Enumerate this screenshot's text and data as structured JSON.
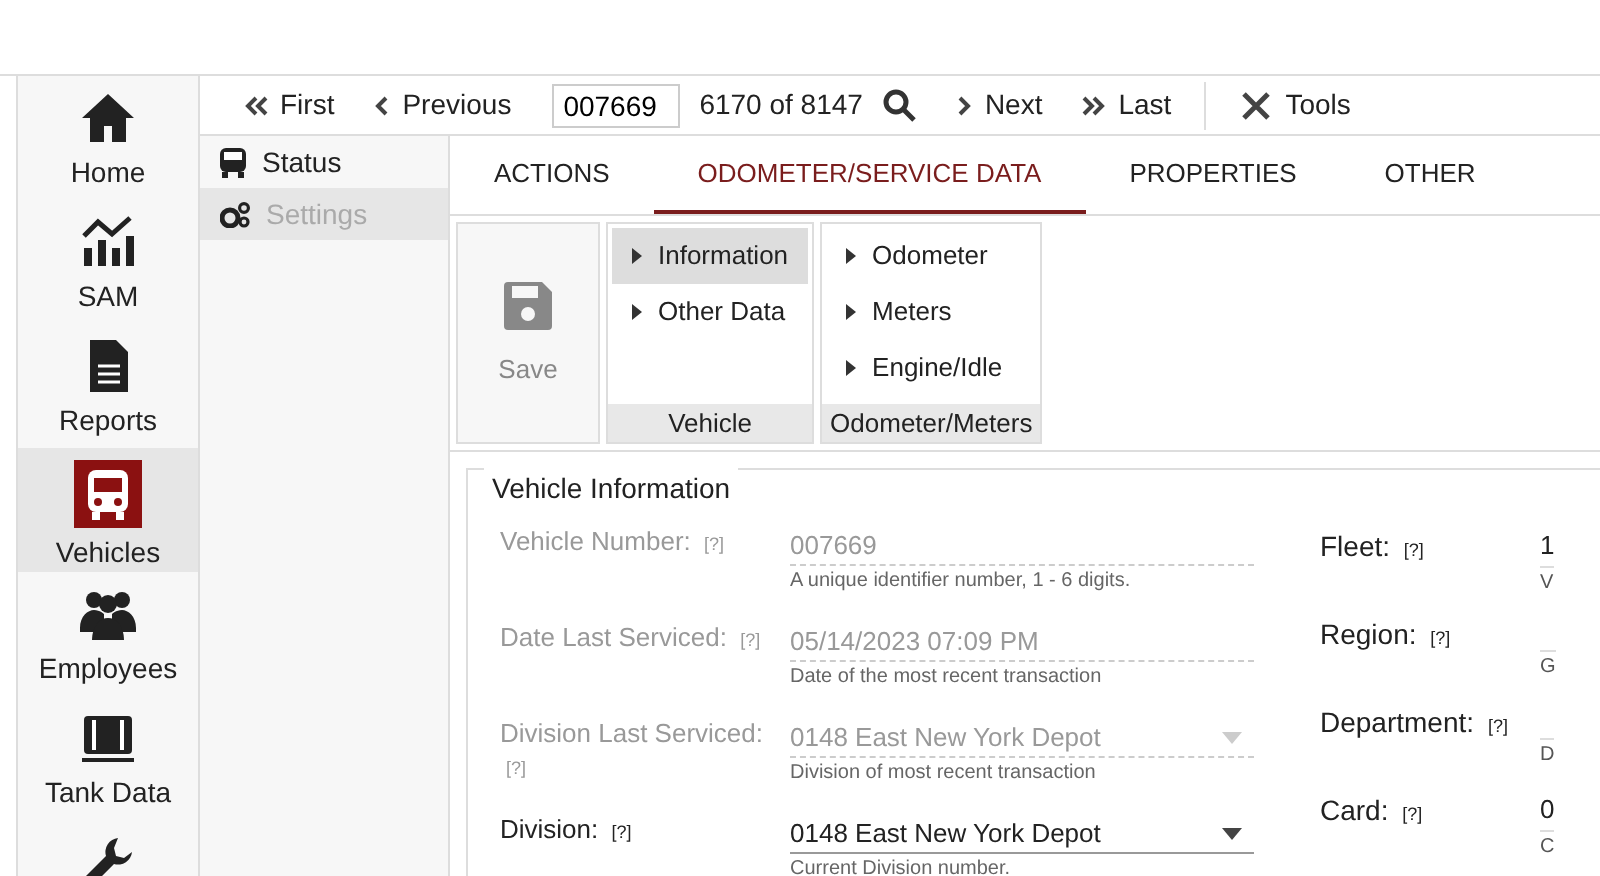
{
  "nav": [
    {
      "kind": "home",
      "label": "Home",
      "selected": false
    },
    {
      "kind": "chart",
      "label": "SAM",
      "selected": false
    },
    {
      "kind": "document",
      "label": "Reports",
      "selected": false
    },
    {
      "kind": "bus",
      "label": "Vehicles",
      "selected": true
    },
    {
      "kind": "people",
      "label": "Employees",
      "selected": false
    },
    {
      "kind": "tank",
      "label": "Tank Data",
      "selected": false
    },
    {
      "kind": "wrench",
      "selected": false
    }
  ],
  "toolbar": {
    "first": "First",
    "previous": "Previous",
    "record": "007669",
    "position": "6170 of 8147",
    "next": "Next",
    "last": "Last",
    "tools": "Tools"
  },
  "submenu": [
    {
      "kind": "bus",
      "label": "Status",
      "selected": false
    },
    {
      "kind": "gears",
      "label": "Settings",
      "selected": true
    }
  ],
  "tabs": [
    {
      "label": "ACTIONS",
      "selected": false
    },
    {
      "label": "ODOMETER/SERVICE DATA",
      "selected": true
    },
    {
      "label": "PROPERTIES",
      "selected": false
    },
    {
      "label": "OTHER",
      "selected": false
    }
  ],
  "ribbon": {
    "save": {
      "label": "Save",
      "disabled": true
    },
    "groups": [
      {
        "title": "Vehicle",
        "items": [
          {
            "label": "Information",
            "selected": true
          },
          {
            "label": "Other Data",
            "selected": false
          }
        ]
      },
      {
        "title": "Odometer/Meters",
        "items": [
          {
            "label": "Odometer",
            "selected": false
          },
          {
            "label": "Meters",
            "selected": false
          },
          {
            "label": "Engine/Idle",
            "selected": false
          }
        ]
      }
    ]
  },
  "section": {
    "title": "Vehicle Information",
    "fields": [
      {
        "kind": "text",
        "label": "Vehicle Number:",
        "help": "[?]",
        "value": "007669",
        "hint": "A unique identifier number, 1 - 6 digits.",
        "disabled": true
      },
      {
        "kind": "text",
        "label": "Date Last Serviced:",
        "help": "[?]",
        "value": "05/14/2023 07:09 PM",
        "hint": "Date of the most recent transaction",
        "disabled": true
      },
      {
        "kind": "select",
        "label": "Division Last Serviced:",
        "help": "[?]",
        "value": "0148 East New York Depot",
        "hint": "Division of most recent transaction",
        "disabled": true
      },
      {
        "kind": "select",
        "label": "Division:",
        "help": "[?]",
        "value": "0148 East New York Depot",
        "hint": "Current Division number.",
        "disabled": false
      }
    ],
    "right_fields": [
      {
        "label": "Fleet:",
        "help": "[?]",
        "value": "1",
        "hint": "V"
      },
      {
        "label": "Region:",
        "help": "[?]",
        "hint": "G"
      },
      {
        "label": "Department:",
        "help": "[?]",
        "hint": "D"
      },
      {
        "label": "Card:",
        "help": "[?]",
        "value": "0",
        "hint": "C"
      }
    ]
  }
}
